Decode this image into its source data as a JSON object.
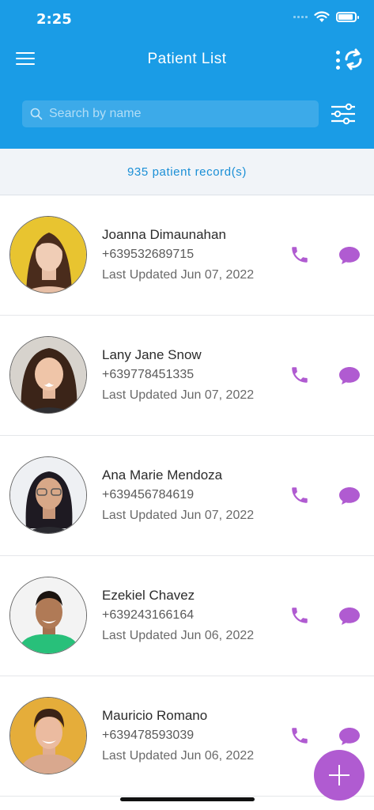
{
  "status_bar": {
    "time": "2:25"
  },
  "header": {
    "title": "Patient List"
  },
  "search": {
    "placeholder": "Search by name"
  },
  "records": {
    "count_text": "935 patient record(s)"
  },
  "colors": {
    "header_bg": "#1a9ce6",
    "accent": "#b05bd1",
    "records_text": "#1a8fd6"
  },
  "patients": [
    {
      "name": "Joanna Dimaunahan",
      "phone": "+639532689715",
      "updated": "Last Updated Jun 07, 2022"
    },
    {
      "name": "Lany Jane Snow",
      "phone": "+639778451335",
      "updated": "Last Updated Jun 07, 2022"
    },
    {
      "name": "Ana Marie Mendoza",
      "phone": "+639456784619",
      "updated": "Last Updated Jun 07, 2022"
    },
    {
      "name": "Ezekiel Chavez",
      "phone": "+639243166164",
      "updated": "Last Updated Jun 06, 2022"
    },
    {
      "name": "Mauricio Romano",
      "phone": "+639478593039",
      "updated": "Last Updated Jun 06, 2022"
    }
  ],
  "icons": {
    "menu": "hamburger-icon",
    "more": "more-vertical-icon",
    "refresh": "refresh-icon",
    "search": "search-icon",
    "filter": "filter-sliders-icon",
    "call": "phone-icon",
    "message": "chat-bubble-icon",
    "add": "plus-icon"
  }
}
